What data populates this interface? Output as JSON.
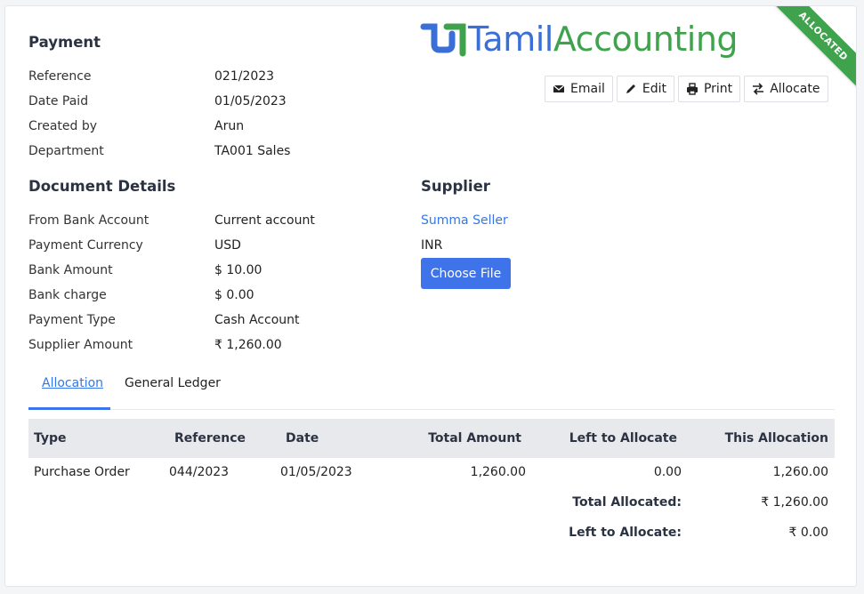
{
  "header": {
    "title": "Payment",
    "status_ribbon": "ALLOCATED",
    "logo": {
      "part1": "Tamil",
      "part2": "Accounting"
    }
  },
  "payment": [
    {
      "label": "Reference",
      "value": "021/2023"
    },
    {
      "label": "Date Paid",
      "value": "01/05/2023"
    },
    {
      "label": "Created by",
      "value": "Arun"
    },
    {
      "label": "Department",
      "value": "TA001 Sales"
    }
  ],
  "actions": {
    "email": "Email",
    "edit": "Edit",
    "print": "Print",
    "allocate": "Allocate"
  },
  "document_details": {
    "title": "Document Details",
    "rows": [
      {
        "label": "From Bank Account",
        "value": "Current account"
      },
      {
        "label": "Payment Currency",
        "value": "USD"
      },
      {
        "label": "Bank Amount",
        "value": "$ 10.00"
      },
      {
        "label": "Bank charge",
        "value": "$ 0.00"
      },
      {
        "label": "Payment Type",
        "value": "Cash Account"
      },
      {
        "label": "Supplier Amount",
        "value": "₹ 1,260.00"
      }
    ]
  },
  "supplier": {
    "title": "Supplier",
    "name": "Summa Seller",
    "currency": "INR",
    "choose_file": "Choose File"
  },
  "tabs": {
    "allocation": "Allocation",
    "general_ledger": "General Ledger"
  },
  "allocation_table": {
    "headers": {
      "type": "Type",
      "reference": "Reference",
      "date": "Date",
      "total_amount": "Total Amount",
      "left_to_allocate": "Left to Allocate",
      "this_allocation": "This Allocation"
    },
    "rows": [
      {
        "type": "Purchase Order",
        "reference": "044/2023",
        "date": "01/05/2023",
        "total_amount": "1,260.00",
        "left_to_allocate": "0.00",
        "this_allocation": "1,260.00"
      }
    ],
    "totals": {
      "total_allocated_label": "Total Allocated:",
      "total_allocated_value": "₹ 1,260.00",
      "left_to_allocate_label": "Left to Allocate:",
      "left_to_allocate_value": "₹ 0.00"
    }
  },
  "colors": {
    "accent": "#3e73ea",
    "link": "#3577e8",
    "ribbon": "#3fa34d"
  }
}
